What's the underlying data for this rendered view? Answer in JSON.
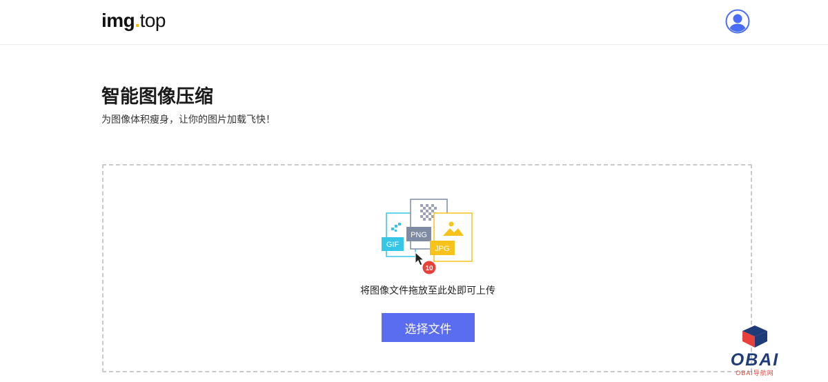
{
  "header": {
    "logo": {
      "part1": "img",
      "dot": ".",
      "part2": "top"
    },
    "avatar_icon": "user-avatar-icon"
  },
  "main": {
    "title": "智能图像压缩",
    "subtitle": "为图像体积瘦身，让你的图片加载飞快！",
    "dropzone": {
      "illustration": {
        "gif_label": "GIF",
        "png_label": "PNG",
        "jpg_label": "JPG",
        "count_badge": "10"
      },
      "instruction": "将图像文件拖放至此处即可上传",
      "select_button": "选择文件"
    }
  },
  "watermark": {
    "brand": "OBAI",
    "caption": "OBAI导航网"
  },
  "colors": {
    "accent_button": "#5a6cf0",
    "logo_dot": "#f5b800",
    "avatar_blue": "#4a6cf7",
    "gif_cyan": "#35c6e8",
    "png_gray": "#7f8aa3",
    "jpg_yellow": "#f7c21a",
    "badge_red": "#e8413b",
    "watermark_navy": "#1f3b78"
  }
}
